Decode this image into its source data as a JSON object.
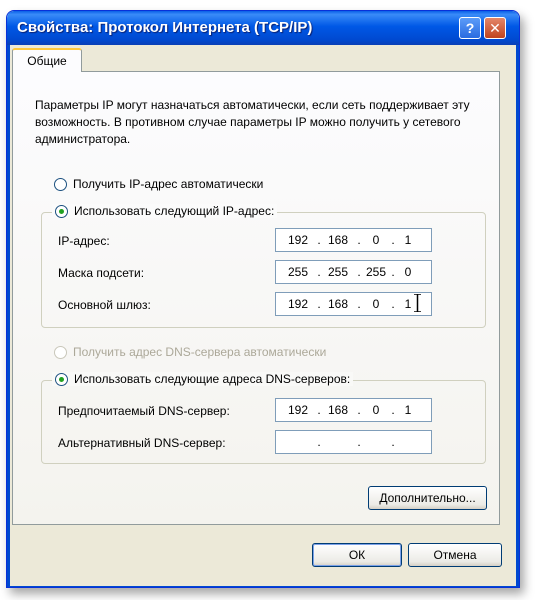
{
  "window": {
    "title": "Свойства: Протокол Интернета (TCP/IP)",
    "help_glyph": "?",
    "close_glyph": "✕"
  },
  "tabs": [
    {
      "label": "Общие"
    }
  ],
  "description": "Параметры IP могут назначаться автоматически, если сеть поддерживает эту возможность. В противном случае параметры IP можно получить у сетевого администратора.",
  "ip_mode": {
    "auto_label": "Получить IP-адрес автоматически",
    "manual_label": "Использовать следующий IP-адрес:",
    "selected": "manual"
  },
  "ip_fields": {
    "ip_label": "IP-адрес:",
    "ip_value": [
      "192",
      "168",
      "0",
      "1"
    ],
    "mask_label": "Маска подсети:",
    "mask_value": [
      "255",
      "255",
      "255",
      "0"
    ],
    "gateway_label": "Основной шлюз:",
    "gateway_value": [
      "192",
      "168",
      "0",
      "1"
    ],
    "separator": "."
  },
  "dns_mode": {
    "auto_label": "Получить адрес DNS-сервера автоматически",
    "manual_label": "Использовать следующие адреса DNS-серверов:",
    "selected": "manual",
    "auto_disabled": true
  },
  "dns_fields": {
    "preferred_label": "Предпочитаемый DNS-сервер:",
    "preferred_value": [
      "192",
      "168",
      "0",
      "1"
    ],
    "alternate_label": "Альтернативный DNS-сервер:",
    "alternate_value": [
      "",
      "",
      "",
      ""
    ]
  },
  "buttons": {
    "advanced": "Дополнительно...",
    "ok": "ОК",
    "cancel": "Отмена"
  },
  "colors": {
    "title_bar": "#0058e6",
    "dialog_bg": "#ece9d8",
    "radio_dot": "#21a121",
    "close_button": "#c0431e"
  }
}
